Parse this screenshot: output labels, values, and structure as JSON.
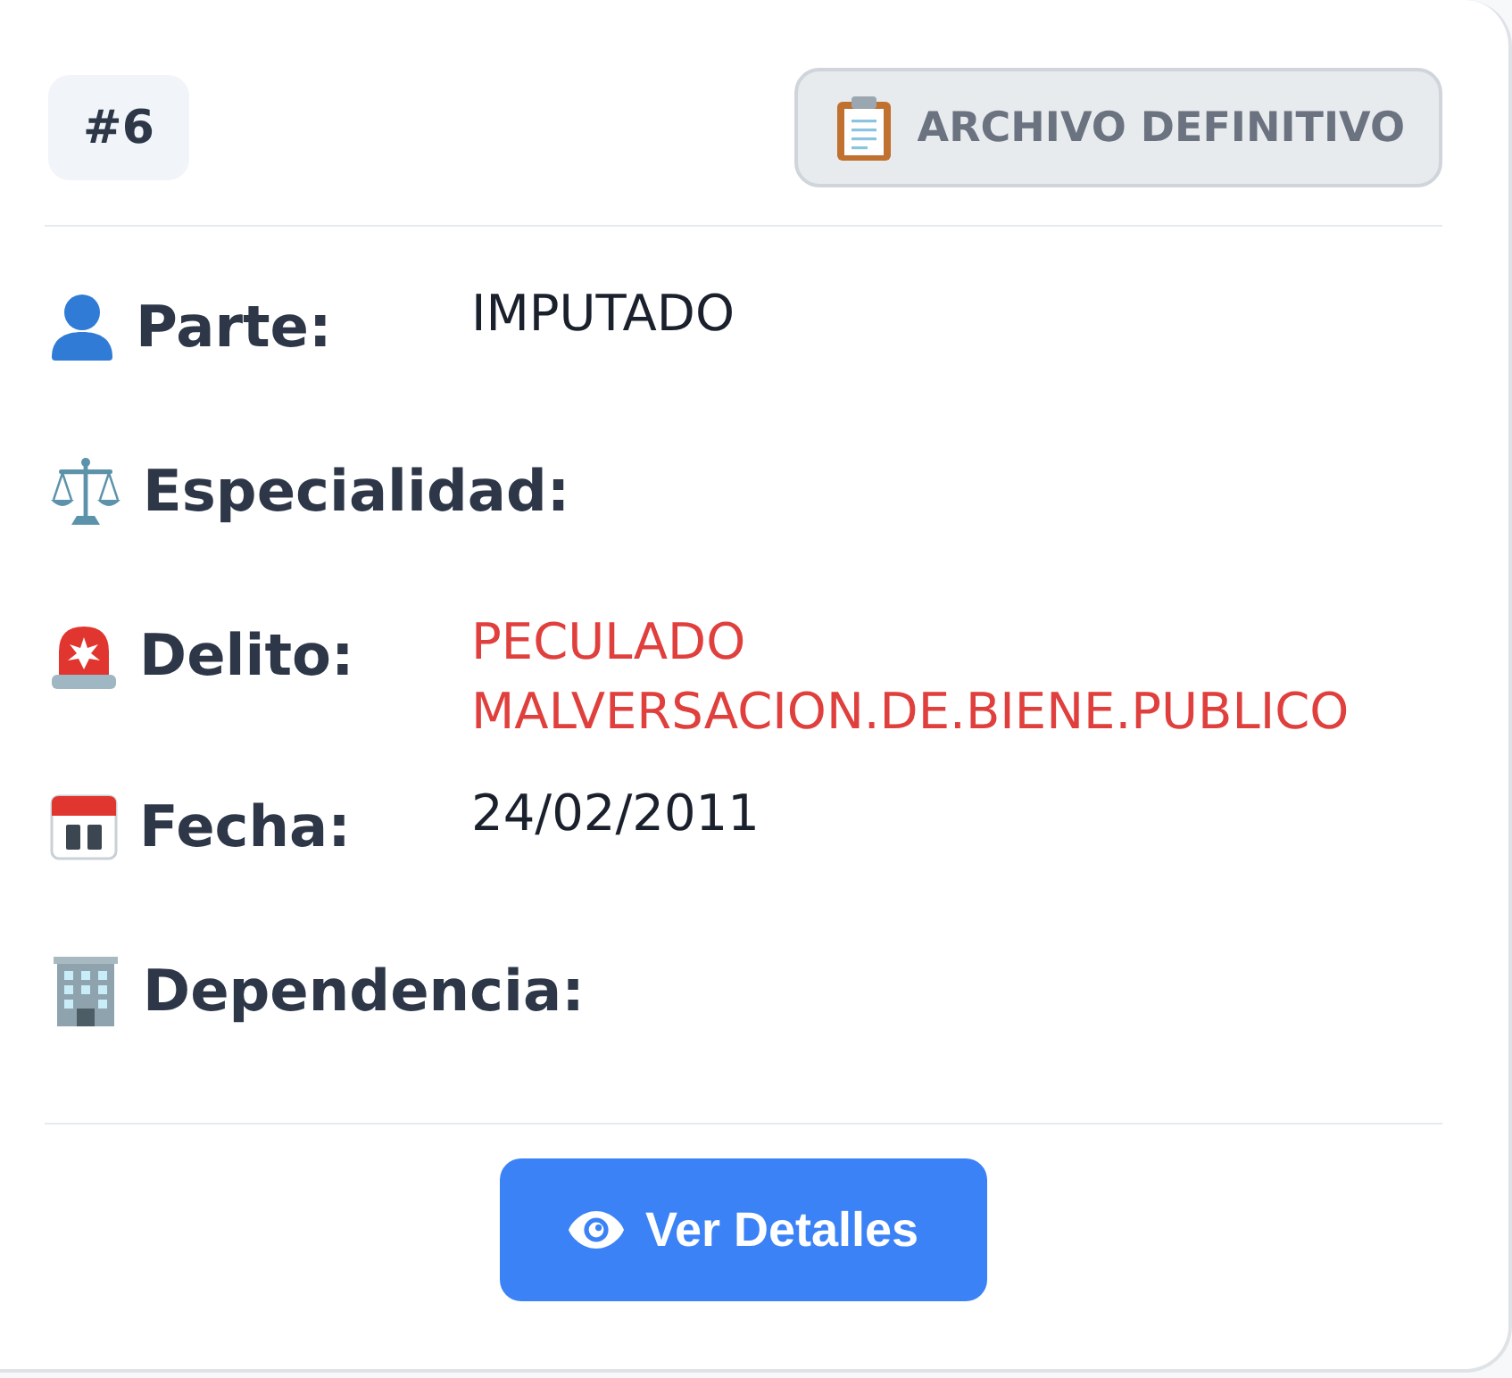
{
  "header": {
    "number": "#6",
    "status": {
      "label": "ARCHIVO DEFINITIVO"
    }
  },
  "fields": [
    {
      "label": "Parte:",
      "value": "IMPUTADO",
      "kind": "text"
    },
    {
      "label": "Especialidad:"
    },
    {
      "label": "Delito:",
      "value": "PECULADO MALVERSACION.DE.BIENE.PUBLICO",
      "kind": "alert"
    },
    {
      "label": "Fecha:",
      "value": "24/02/2011",
      "kind": "text"
    },
    {
      "label": "Dependencia:"
    }
  ],
  "action": {
    "label": "Ver Detalles"
  }
}
